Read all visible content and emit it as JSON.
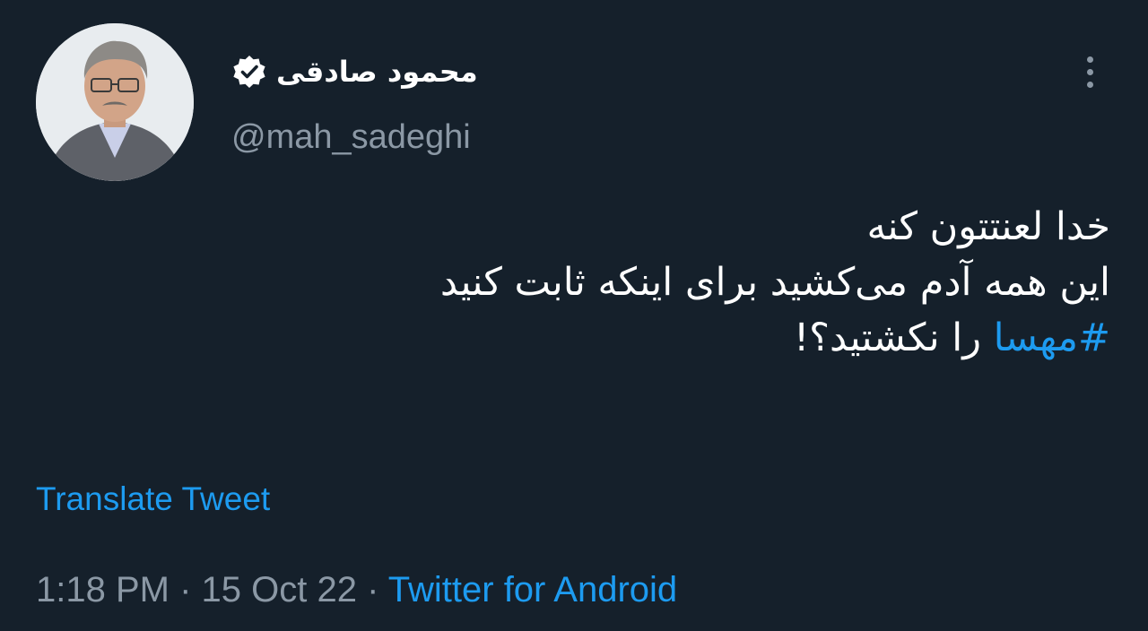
{
  "author": {
    "display_name": "محمود صادقی",
    "handle": "@mah_sadeghi",
    "verified": true
  },
  "tweet": {
    "line1": "خدا لعنتتون کنه",
    "line2": "این همه آدم می‌کشید برای اینکه ثابت کنید",
    "hashtag": "#مهسا",
    "line3_rest": " را نکشتید؟!"
  },
  "translate_label": "Translate Tweet",
  "meta": {
    "time": "1:18 PM",
    "separator1": " · ",
    "date": "15 Oct 22",
    "separator2": " · ",
    "source": "Twitter for Android"
  },
  "colors": {
    "background": "#15202b",
    "link": "#1d9bf0",
    "secondary_text": "#8b98a5"
  },
  "icons": {
    "verified": "verified-badge-icon",
    "more": "more-vertical-icon"
  }
}
